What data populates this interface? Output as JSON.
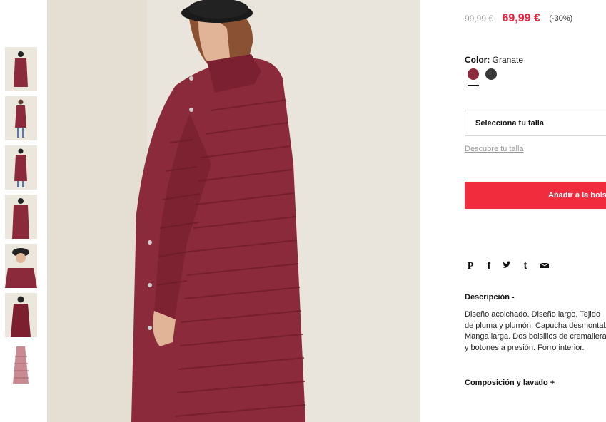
{
  "product": {
    "price_old": "99,99 €",
    "price_new": "69,99 €",
    "discount": "(-30%)",
    "color_label": "Color:",
    "color_value": "Granate",
    "swatch_colors": [
      "#8b2a3a",
      "#3a3a3a"
    ],
    "size_select": "Selecciona tu talla",
    "size_guide": "Descubre tu talla",
    "add_to_bag": "Añadir a la bolsa",
    "description_title": "Descripción -",
    "description_lines": [
      "Diseño acolchado. Diseño largo. Tejido",
      "de pluma y plumón. Capucha desmontable.",
      "Manga larga. Dos bolsillos de cremallera",
      "y botones a presión. Forro interior."
    ],
    "composition_title": "Composición y lavado +"
  },
  "social_icons": [
    "pinterest-icon",
    "facebook-icon",
    "twitter-icon",
    "tumblr-icon",
    "email-icon"
  ],
  "colors": {
    "accent": "#f12c3c",
    "price": "#e5233d",
    "coat": "#8b2a3a"
  }
}
